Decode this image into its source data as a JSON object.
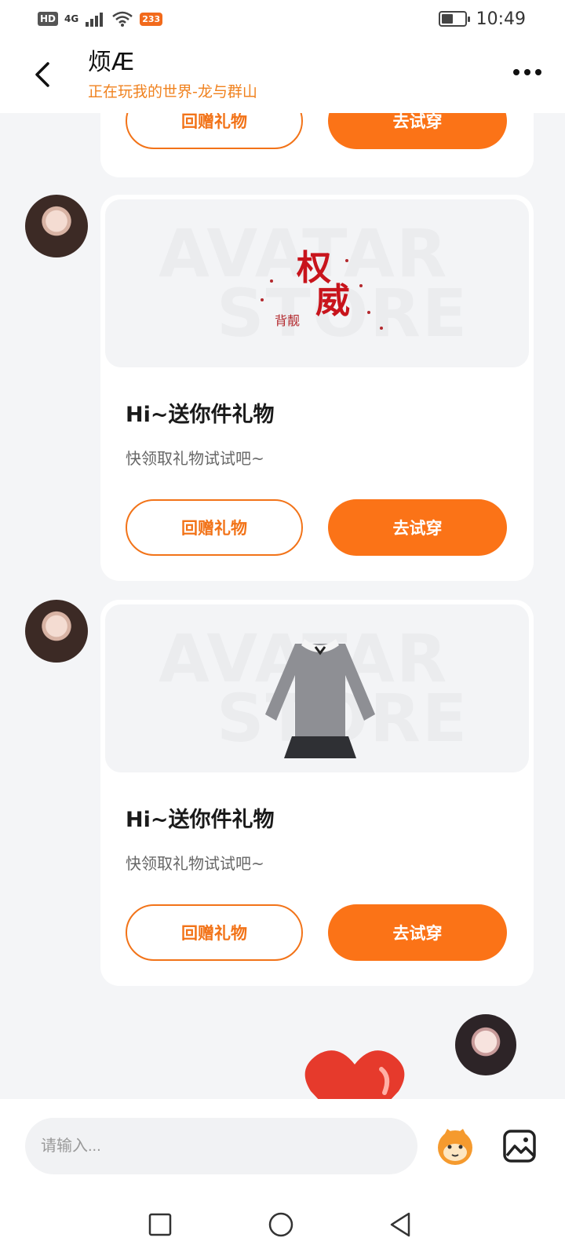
{
  "status_bar": {
    "hd": "HD",
    "network": "4G",
    "app_badge": "233",
    "time": "10:49",
    "battery_level": 0.5
  },
  "header": {
    "back_icon": "chevron-left-icon",
    "title": "烦Æ",
    "subtitle": "正在玩我的世界-龙与群山",
    "more_icon": "more-horizontal-icon"
  },
  "messages": [
    {
      "button_return": "回赠礼物",
      "button_try": "去试穿"
    },
    {
      "image": "gift-accessory-calligraphy",
      "title": "Hi~送你件礼物",
      "desc": "快领取礼物试试吧~",
      "button_return": "回赠礼物",
      "button_try": "去试穿"
    },
    {
      "image": "gift-sweater-skirt",
      "title": "Hi~送你件礼物",
      "desc": "快领取礼物试试吧~",
      "button_return": "回赠礼物",
      "button_try": "去试穿"
    }
  ],
  "watermark": {
    "line1": "AVATAR",
    "line2": "STORE"
  },
  "calligraphy": {
    "main1": "权",
    "main2": "威",
    "side": "背靓"
  },
  "input": {
    "placeholder": "请输入..."
  },
  "colors": {
    "accent": "#fb7317",
    "subtitle": "#f0821f"
  }
}
